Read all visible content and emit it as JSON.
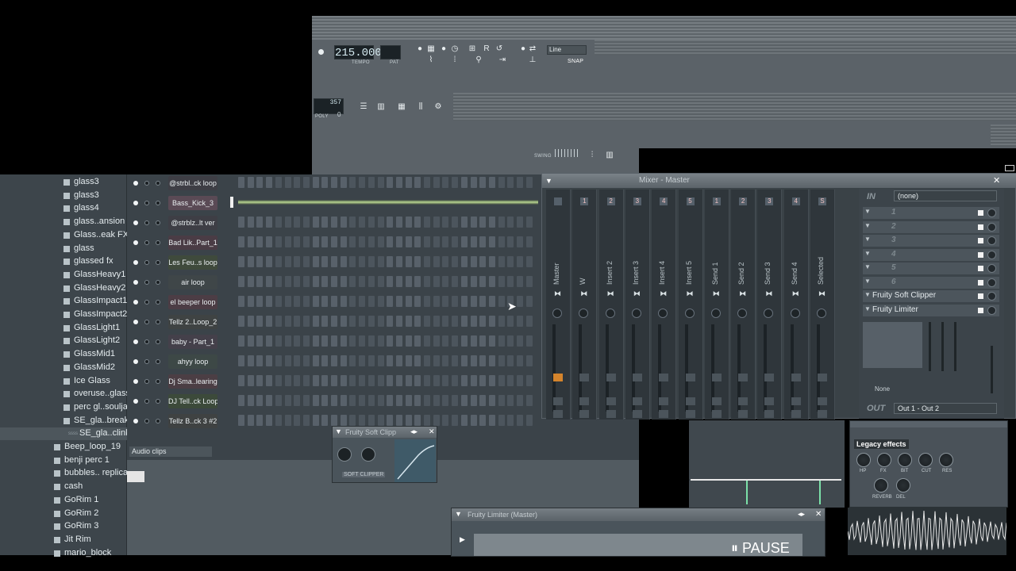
{
  "toolbar": {
    "tempo_value": "215.000",
    "tempo_label": "TEMPO",
    "pat_label": "PAT",
    "snap_mode": "Line",
    "snap_label": "SNAP",
    "cpu_value": "357",
    "poly_label": "POLY",
    "poly_value": "0",
    "swing_label": "SWING"
  },
  "browser": {
    "items": [
      {
        "label": "glass3",
        "type": "folder"
      },
      {
        "label": "glass3",
        "type": "folder"
      },
      {
        "label": "glass4",
        "type": "folder"
      },
      {
        "label": "glass..ansion",
        "type": "folder"
      },
      {
        "label": "Glass..eak FX",
        "type": "folder"
      },
      {
        "label": "glass",
        "type": "folder"
      },
      {
        "label": "glassed fx",
        "type": "folder"
      },
      {
        "label": "GlassHeavy1",
        "type": "folder"
      },
      {
        "label": "GlassHeavy2",
        "type": "folder"
      },
      {
        "label": "GlassImpact1",
        "type": "folder"
      },
      {
        "label": "GlassImpact2",
        "type": "folder"
      },
      {
        "label": "GlassLight1",
        "type": "folder"
      },
      {
        "label": "GlassLight2",
        "type": "folder"
      },
      {
        "label": "GlassMid1",
        "type": "folder"
      },
      {
        "label": "GlassMid2",
        "type": "folder"
      },
      {
        "label": "Ice Glass",
        "type": "folder"
      },
      {
        "label": "overuse..glass",
        "type": "folder"
      },
      {
        "label": "perc gl..soulja",
        "type": "folder"
      },
      {
        "label": "SE_gla..break",
        "type": "folder"
      },
      {
        "label": "SE_gla..clink",
        "type": "file"
      },
      {
        "label": "Beep_loop_19",
        "type": "folder"
      },
      {
        "label": "benji perc 1",
        "type": "folder"
      },
      {
        "label": "bubbles.. replica",
        "type": "folder"
      },
      {
        "label": "cash",
        "type": "folder"
      },
      {
        "label": "GoRim 1",
        "type": "folder"
      },
      {
        "label": "GoRim 2",
        "type": "folder"
      },
      {
        "label": "GoRim 3",
        "type": "folder"
      },
      {
        "label": "Jit Rim",
        "type": "folder"
      },
      {
        "label": "mario_block",
        "type": "folder"
      }
    ]
  },
  "rack": {
    "channels": [
      {
        "name": "@strbl..ck loop",
        "color": "#3e3e45"
      },
      {
        "name": "Bass_Kick_3",
        "color": "#5a4a55"
      },
      {
        "name": "@strblz..lt ver",
        "color": "#3e3e45"
      },
      {
        "name": "Bad Lik..Part_1",
        "color": "#4a3c45"
      },
      {
        "name": "Les Feu..s loop",
        "color": "#3f4a3c"
      },
      {
        "name": "air loop",
        "color": "#3f4648"
      },
      {
        "name": "el beeper loop",
        "color": "#4c3d45"
      },
      {
        "name": "Tellz 2..Loop_2",
        "color": "#3f4343"
      },
      {
        "name": "baby - Part_1",
        "color": "#44404a"
      },
      {
        "name": "ahyy loop",
        "color": "#3d4846"
      },
      {
        "name": "Dj Sma..learing",
        "color": "#4b3e44"
      },
      {
        "name": "DJ Tell..ck Loop",
        "color": "#3c4a3a"
      },
      {
        "name": "Tellz B..ck 3 #2",
        "color": "#3f4242"
      }
    ],
    "audio_clips_label": "Audio clips"
  },
  "mixer": {
    "title": "Mixer - Master",
    "strips": [
      {
        "name": "Master",
        "num": ""
      },
      {
        "name": "W",
        "num": "1"
      },
      {
        "name": "Insert 2",
        "num": "2"
      },
      {
        "name": "Insert 3",
        "num": "3"
      },
      {
        "name": "Insert 4",
        "num": "4"
      },
      {
        "name": "Insert 5",
        "num": "5"
      },
      {
        "name": "Send 1",
        "num": "1"
      },
      {
        "name": "Send 2",
        "num": "2"
      },
      {
        "name": "Send 3",
        "num": "3"
      },
      {
        "name": "Send 4",
        "num": "4"
      },
      {
        "name": "Selected",
        "num": "S"
      }
    ],
    "in_label": "IN",
    "in_value": "(none)",
    "slots": [
      "1",
      "2",
      "3",
      "4",
      "5",
      "6"
    ],
    "fx1": "Fruity Soft Clipper",
    "fx2": "Fruity Limiter",
    "out_label": "OUT",
    "out_value": "Out 1 - Out 2",
    "none_label": "None"
  },
  "legacy": {
    "title": "Legacy effects",
    "knobs": [
      "HP",
      "FX",
      "BIT",
      "CUT",
      "RES"
    ],
    "knobs2": [
      "REVERB",
      "DEL"
    ]
  },
  "clipper": {
    "title": "Fruity Soft Clipp",
    "logo": "SOFT CLIPPER"
  },
  "limiter": {
    "title": "Fruity Limiter (Master)",
    "pause": "PAUSE"
  }
}
